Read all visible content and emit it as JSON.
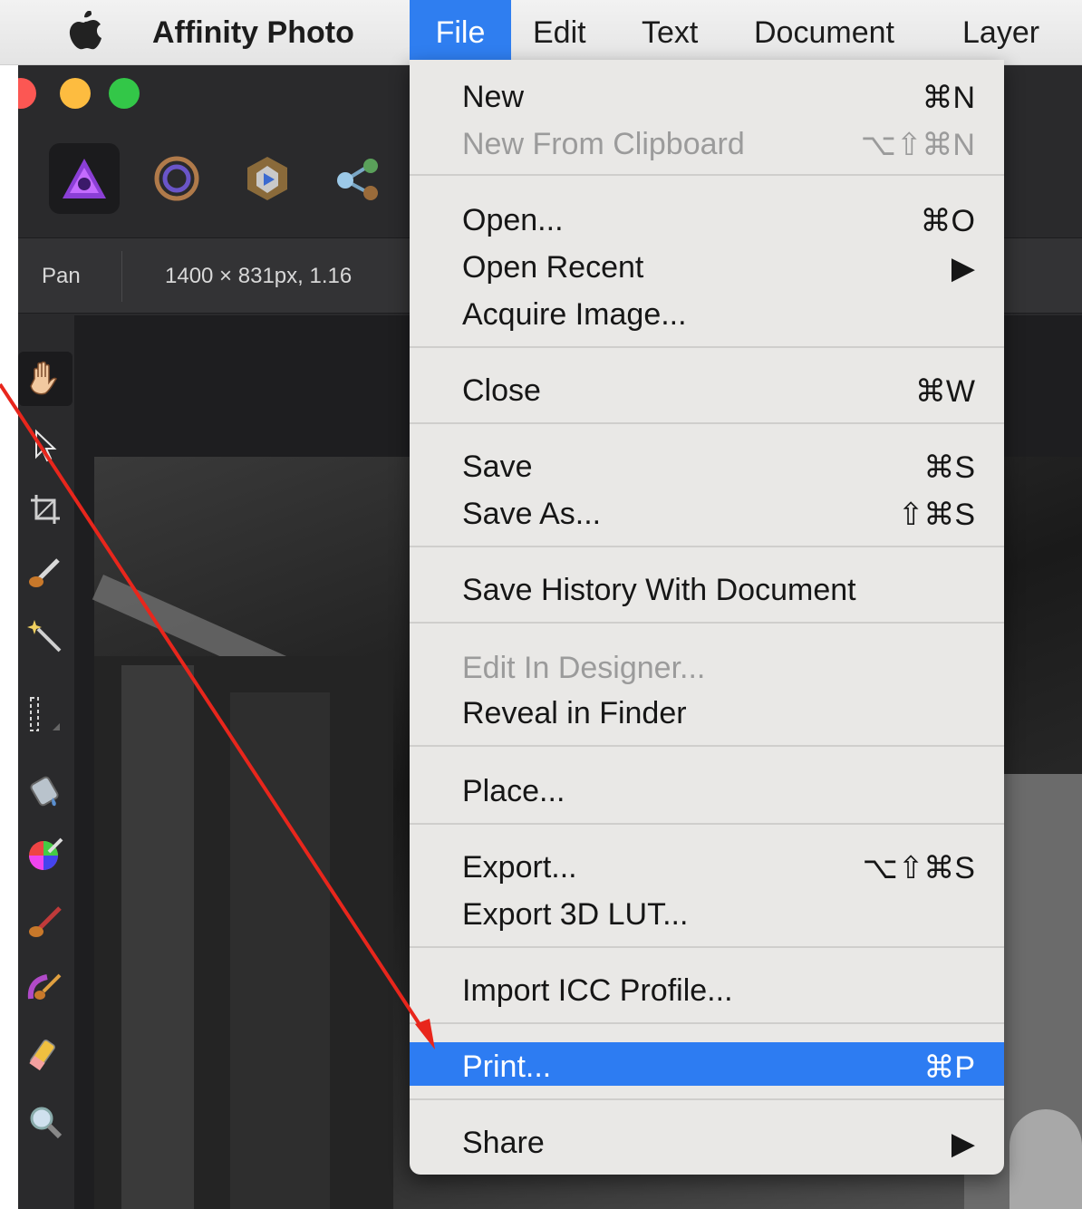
{
  "menubar": {
    "app_name": "Affinity Photo",
    "items": [
      "File",
      "Edit",
      "Text",
      "Document",
      "Layer"
    ]
  },
  "context_bar": {
    "tool_name": "Pan",
    "doc_info": "1400 × 831px, 1.16"
  },
  "file_menu": {
    "items": [
      {
        "label": "New",
        "shortcut": "⌘N",
        "enabled": true
      },
      {
        "label": "New From Clipboard",
        "shortcut": "⌥⇧⌘N",
        "enabled": false
      },
      {
        "label": "Open...",
        "shortcut": "⌘O",
        "enabled": true
      },
      {
        "label": "Open Recent",
        "shortcut": "▶",
        "enabled": true
      },
      {
        "label": "Acquire Image...",
        "shortcut": "",
        "enabled": true
      },
      {
        "label": "Close",
        "shortcut": "⌘W",
        "enabled": true
      },
      {
        "label": "Save",
        "shortcut": "⌘S",
        "enabled": true
      },
      {
        "label": "Save As...",
        "shortcut": "⇧⌘S",
        "enabled": true
      },
      {
        "label": "Save History With Document",
        "shortcut": "",
        "enabled": true
      },
      {
        "label": "Edit In Designer...",
        "shortcut": "",
        "enabled": false
      },
      {
        "label": "Reveal in Finder",
        "shortcut": "",
        "enabled": true
      },
      {
        "label": "Place...",
        "shortcut": "",
        "enabled": true
      },
      {
        "label": "Export...",
        "shortcut": "⌥⇧⌘S",
        "enabled": true
      },
      {
        "label": "Export 3D LUT...",
        "shortcut": "",
        "enabled": true
      },
      {
        "label": "Import ICC Profile...",
        "shortcut": "",
        "enabled": true
      },
      {
        "label": "Print...",
        "shortcut": "⌘P",
        "enabled": true,
        "highlighted": true
      },
      {
        "label": "Share",
        "shortcut": "▶",
        "enabled": true
      }
    ]
  },
  "icons": {
    "menubar": [
      "apple-icon"
    ],
    "personas": [
      "photo-persona-icon",
      "liquify-persona-icon",
      "develop-persona-icon",
      "export-persona-icon"
    ],
    "tools": [
      "hand-icon",
      "pointer-icon",
      "crop-icon",
      "brush-icon",
      "magic-wand-icon",
      "marquee-icon",
      "fill-icon",
      "color-picker-icon",
      "paint-brush-icon",
      "selection-brush-icon",
      "eraser-icon",
      "zoom-icon"
    ]
  },
  "colors": {
    "menu_highlight": "#2d7cf2",
    "annotation_arrow": "#e8261c"
  }
}
